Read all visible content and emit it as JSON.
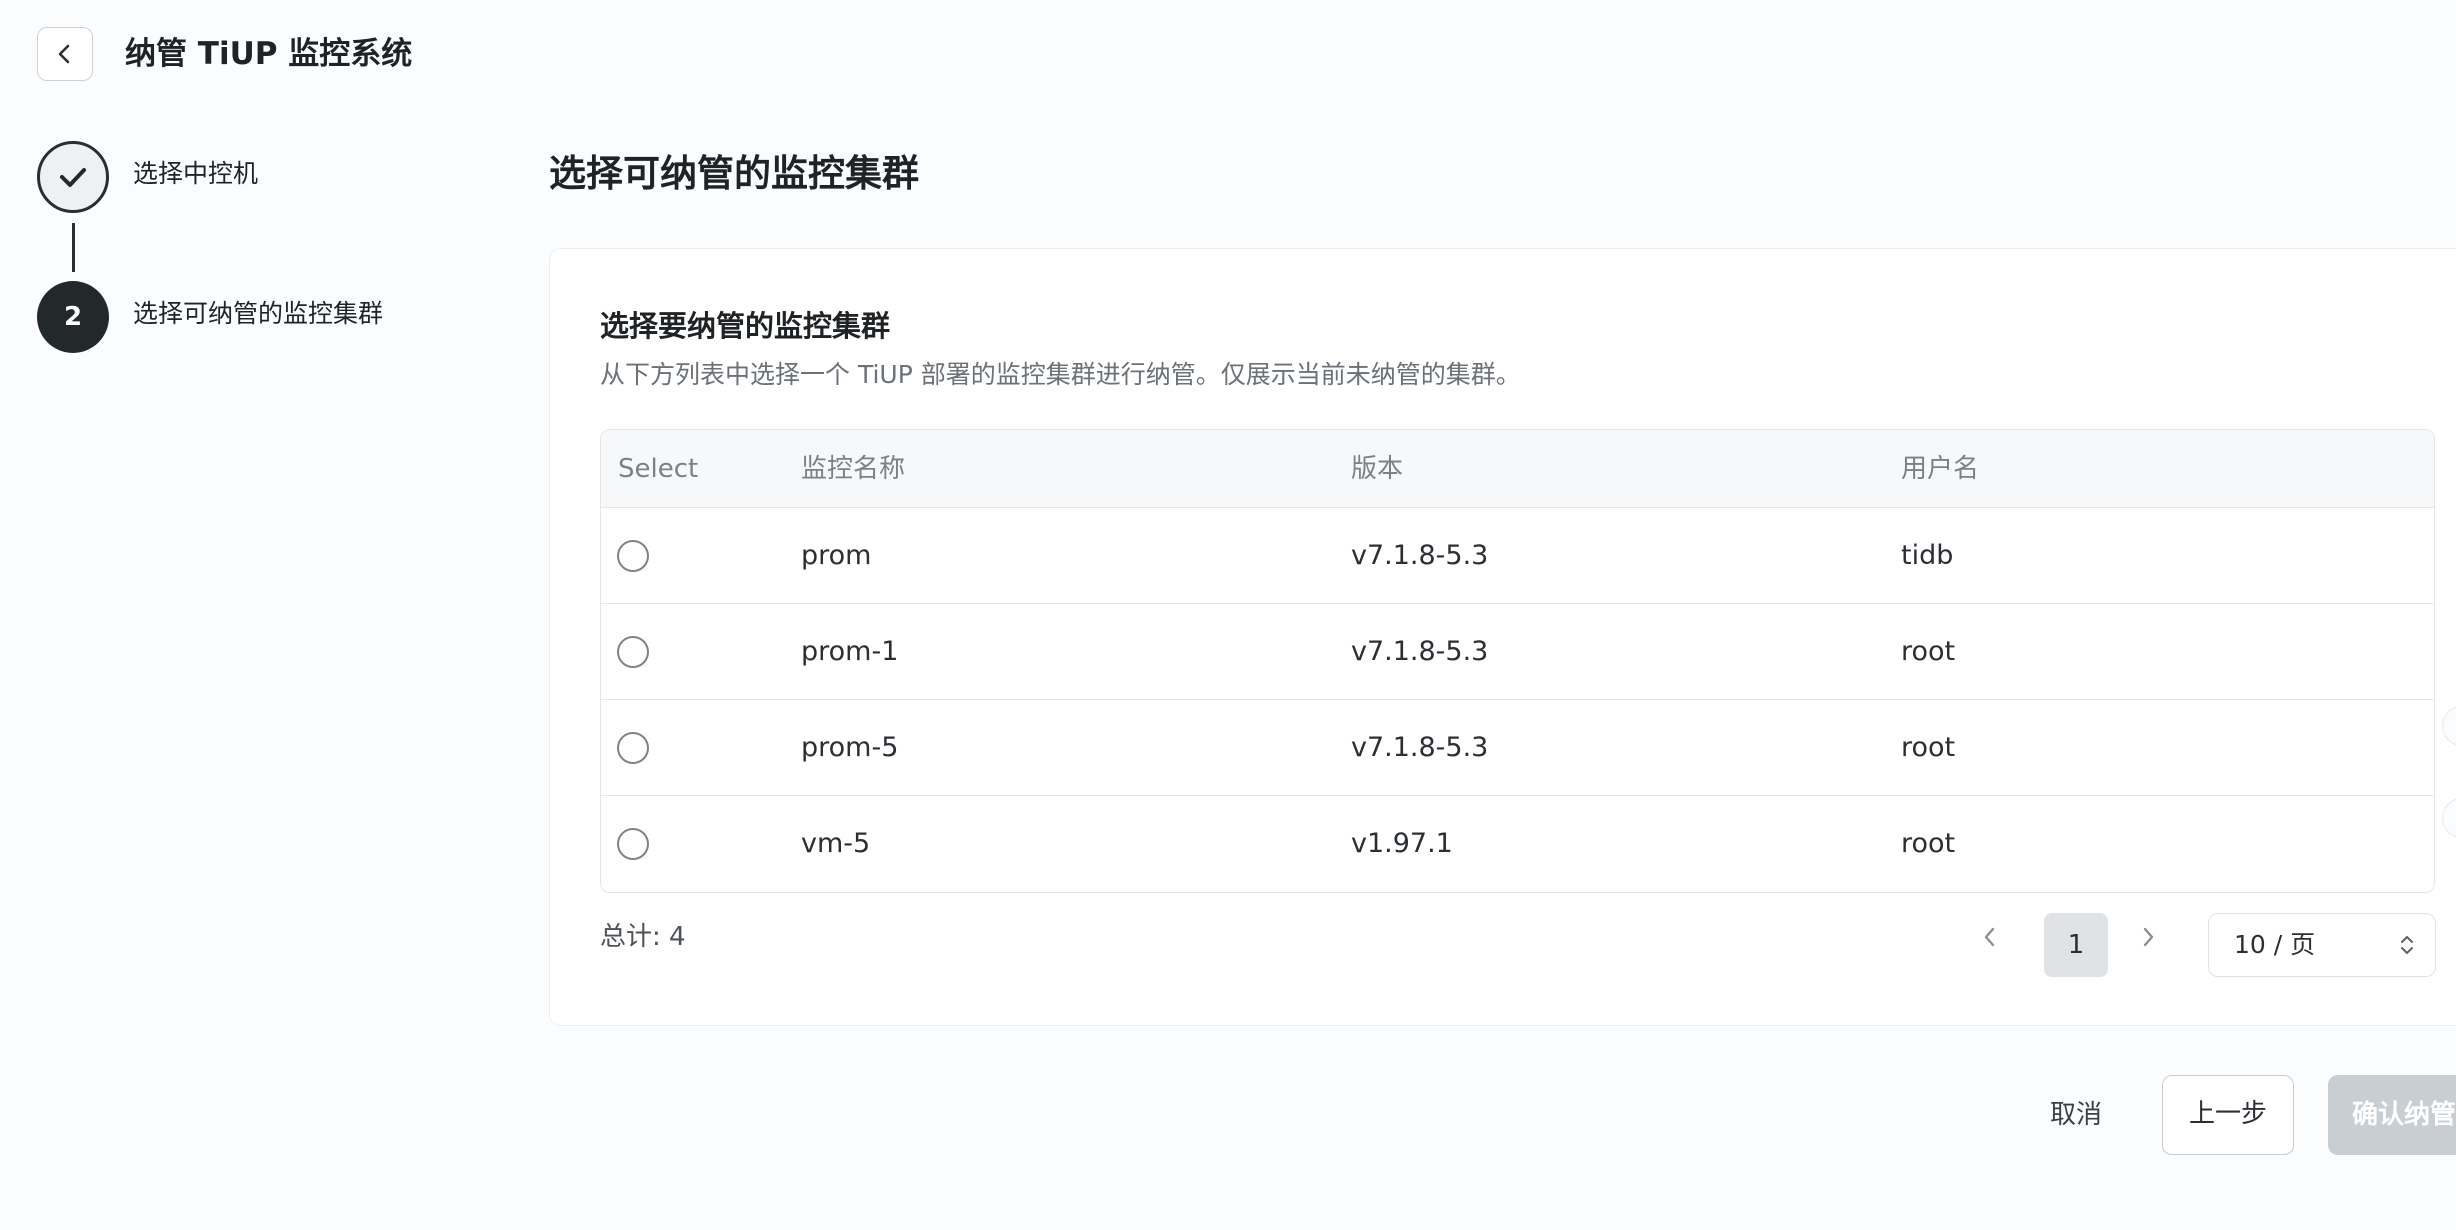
{
  "header": {
    "title": "纳管 TiUP 监控系统"
  },
  "steps": [
    {
      "label": "选择中控机",
      "status": "done"
    },
    {
      "number": "2",
      "label": "选择可纳管的监控集群",
      "status": "active"
    }
  ],
  "section": {
    "title": "选择可纳管的监控集群"
  },
  "card": {
    "title": "选择要纳管的监控集群",
    "description": "从下方列表中选择一个 TiUP 部署的监控集群进行纳管。仅展示当前未纳管的集群。"
  },
  "table": {
    "columns": [
      "Select",
      "监控名称",
      "版本",
      "用户名"
    ],
    "rows": [
      {
        "name": "prom",
        "version": "v7.1.8-5.3",
        "user": "tidb"
      },
      {
        "name": "prom-1",
        "version": "v7.1.8-5.3",
        "user": "root"
      },
      {
        "name": "prom-5",
        "version": "v7.1.8-5.3",
        "user": "root"
      },
      {
        "name": "vm-5",
        "version": "v1.97.1",
        "user": "root"
      }
    ]
  },
  "pagination": {
    "total_label": "总计: 4",
    "current_page": "1",
    "page_size": "10 / 页"
  },
  "actions": {
    "cancel": "取消",
    "previous": "上一步",
    "confirm": "确认纳管"
  },
  "colors": {
    "primary_dark": "#23282b",
    "disabled_button": "#c9ced3",
    "border": "#e3e6e8"
  }
}
